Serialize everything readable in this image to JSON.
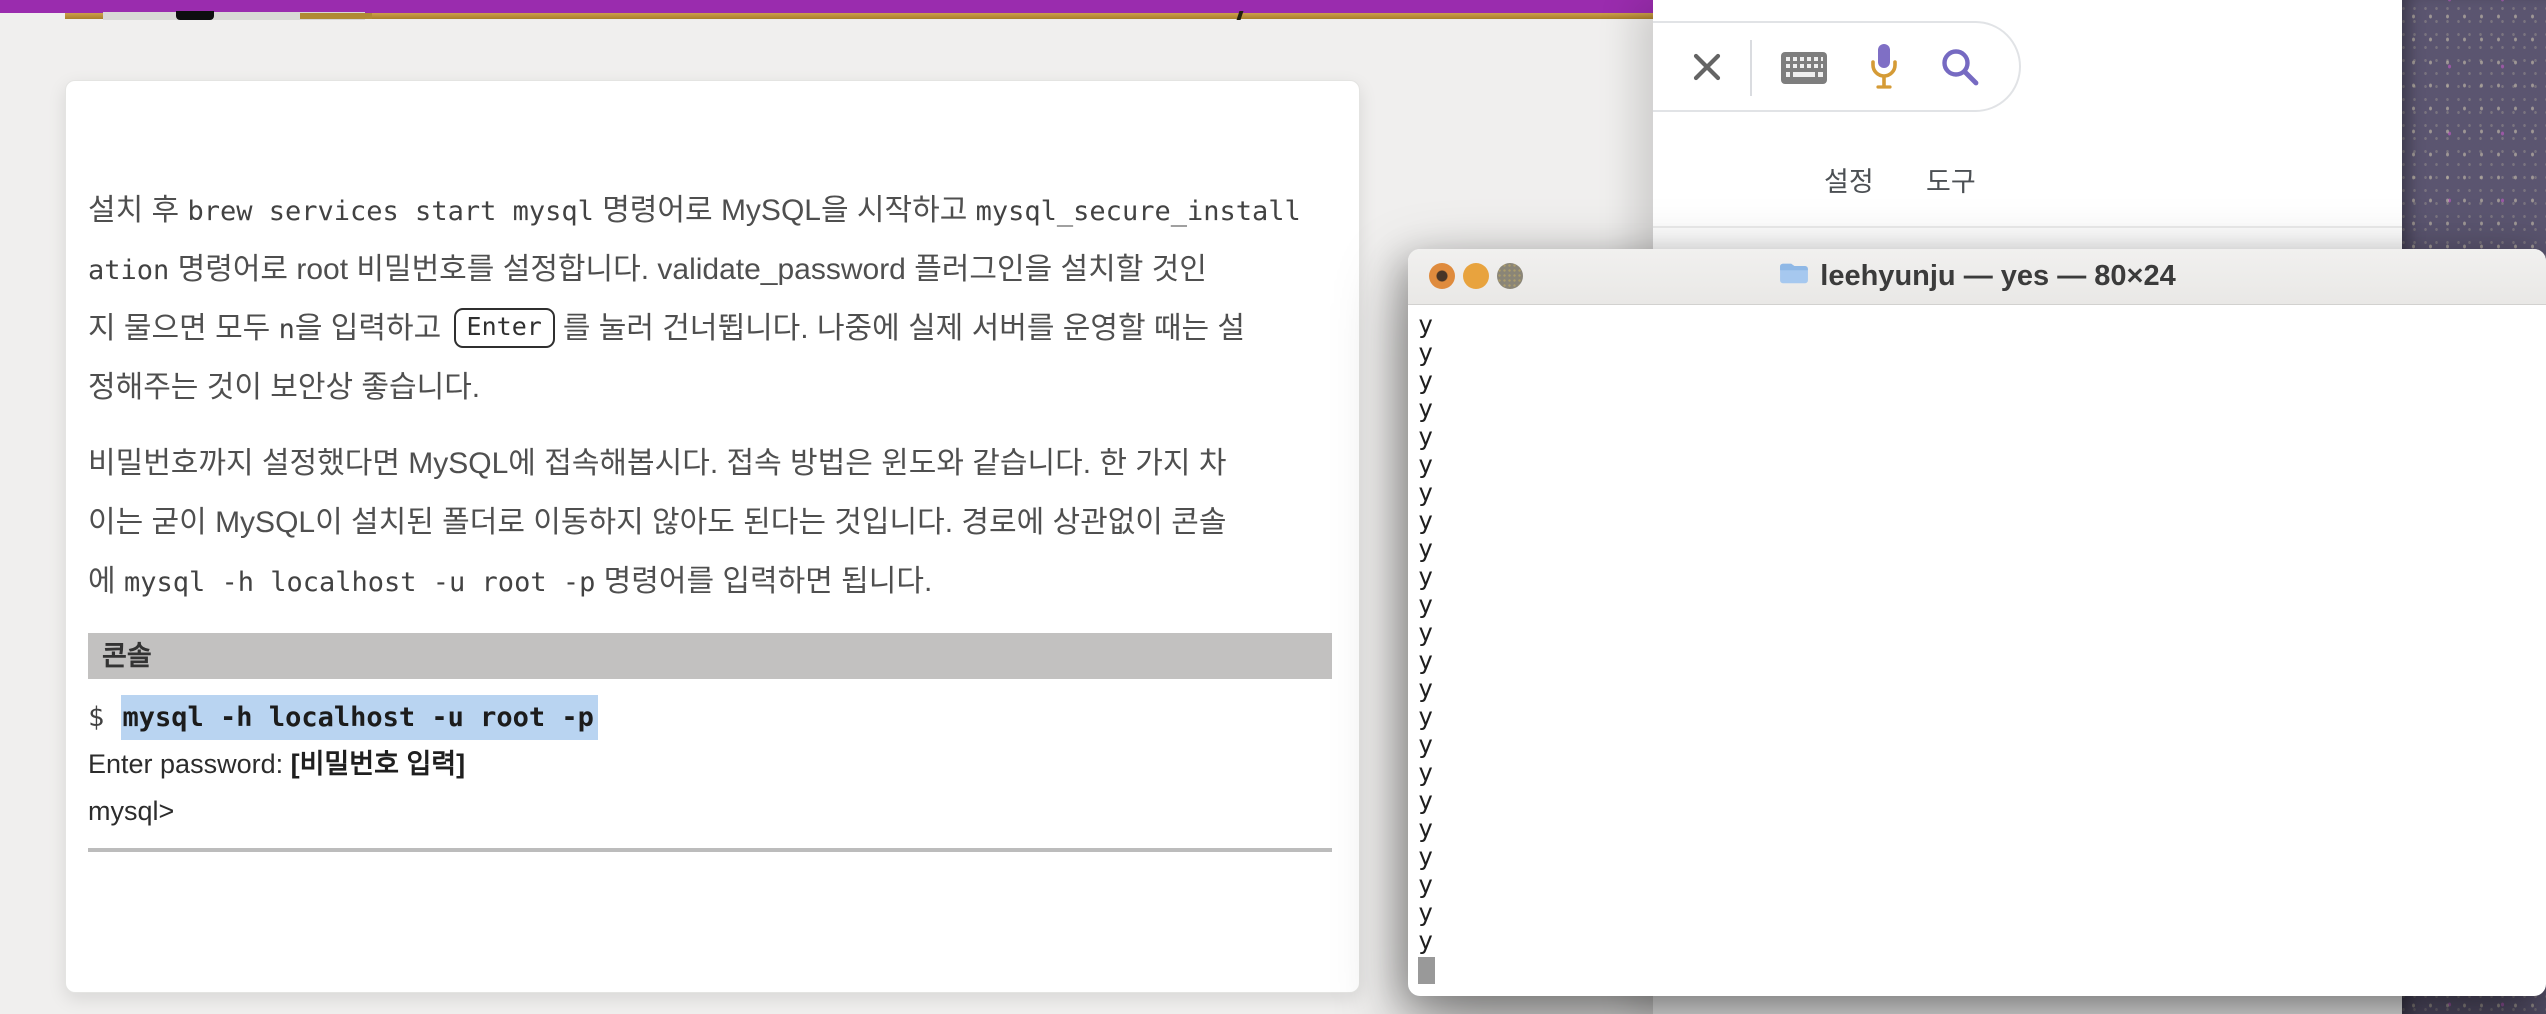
{
  "colors": {
    "purple_header_bar": "#9a2cae",
    "gold_progress_line": "#b08a33",
    "wallpaper_purple": "#5b5570",
    "selection_highlight": "#b9d4f1",
    "console_header_bg": "#c2c1c0",
    "terminal_light_close": "#df8b3d",
    "terminal_light_min": "#e8a33e",
    "terminal_light_max": "#8a8577"
  },
  "article": {
    "paragraphs": [
      {
        "lines": [
          [
            {
              "t": "plain",
              "v": "설치 후 "
            },
            {
              "t": "code",
              "v": "brew services start mysql"
            },
            {
              "t": "plain",
              "v": " 명령어로 MySQL을 시작하고 "
            },
            {
              "t": "code",
              "v": "mysql_secure_install"
            }
          ],
          [
            {
              "t": "code",
              "v": "ation"
            },
            {
              "t": "plain",
              "v": " 명령어로 root 비밀번호를 설정합니다. validate_password 플러그인을 설치할 것인"
            }
          ],
          [
            {
              "t": "plain",
              "v": "지 물으면 모두 "
            },
            {
              "t": "code",
              "v": "n"
            },
            {
              "t": "plain",
              "v": "을 입력하고 "
            },
            {
              "t": "kbd",
              "v": "Enter"
            },
            {
              "t": "plain",
              "v": "를 눌러 건너뜁니다. 나중에 실제 서버를 운영할 때는 설"
            }
          ],
          [
            {
              "t": "plain",
              "v": "정해주는 것이 보안상 좋습니다."
            }
          ]
        ]
      },
      {
        "lines": [
          [
            {
              "t": "plain",
              "v": "비밀번호까지 설정했다면 MySQL에 접속해봅시다. 접속 방법은 윈도와 같습니다. 한 가지 차"
            }
          ],
          [
            {
              "t": "plain",
              "v": "이는 굳이 MySQL이 설치된 폴더로 이동하지 않아도 된다는 것입니다. 경로에 상관없이 콘솔"
            }
          ],
          [
            {
              "t": "plain",
              "v": "에 "
            },
            {
              "t": "code",
              "v": "mysql -h localhost -u root -p"
            },
            {
              "t": "plain",
              "v": " 명령어를 입력하면 됩니다."
            }
          ]
        ]
      }
    ],
    "console_box": {
      "title": "콘솔",
      "lines": [
        [
          {
            "t": "code",
            "v": "$ "
          },
          {
            "t": "code_hl",
            "v": "mysql -h localhost -u root -p"
          }
        ],
        [
          {
            "t": "plain",
            "v": "Enter password: "
          },
          {
            "t": "bold",
            "v": "[비밀번호 입력]"
          }
        ],
        [
          {
            "t": "plain",
            "v": "mysql>"
          }
        ]
      ]
    }
  },
  "search_page": {
    "icons": [
      "close-icon",
      "keyboard-icon",
      "mic-icon",
      "search-icon"
    ],
    "links": [
      {
        "label": "설정"
      },
      {
        "label": "도구"
      }
    ]
  },
  "terminal": {
    "title": "leehyunju — yes — 80×24",
    "folder_icon": "folder-icon",
    "output_char": "y",
    "output_lines": 23
  }
}
